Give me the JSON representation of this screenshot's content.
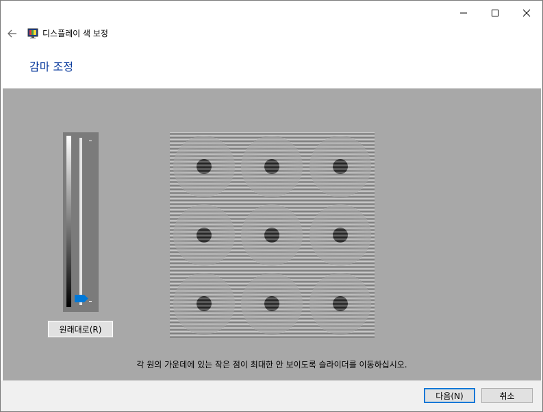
{
  "window": {
    "title": "디스플레이 색 보정",
    "heading": "감마 조정",
    "caption_icons": [
      "minimize-icon",
      "maximize-icon",
      "close-icon"
    ],
    "back_icon": "back-arrow-icon",
    "app_icon": "display-color-calibration-icon"
  },
  "content": {
    "background_color": "#a8a8a8",
    "gamma_slider": {
      "level": 0.0,
      "thumb_color": "#0078d7"
    },
    "reset_button_label": "원래대로(R)",
    "instruction": "각 원의 가운데에 있는 작은 점이 최대한 안 보이도록 슬라이더를 이동하십시오."
  },
  "footer": {
    "next_label": "다음(N)",
    "cancel_label": "취소"
  },
  "colors": {
    "heading": "#003399",
    "accent": "#0078d7"
  }
}
